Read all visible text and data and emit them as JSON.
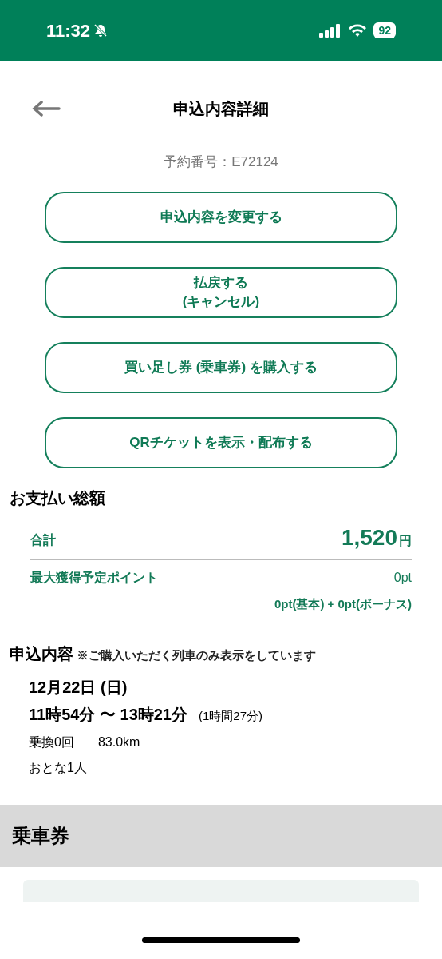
{
  "status_bar": {
    "time": "11:32",
    "battery": "92"
  },
  "header": {
    "title": "申込内容詳細"
  },
  "reservation_number": "予約番号：E72124",
  "actions": [
    {
      "lines": [
        "申込内容を変更する"
      ]
    },
    {
      "lines": [
        "払戻する",
        "(キャンセル)"
      ]
    },
    {
      "lines": [
        "買い足し券 (乗車券) を購入する"
      ]
    },
    {
      "lines": [
        "QRチケットを表示・配布する"
      ]
    }
  ],
  "payment": {
    "heading": "お支払い総額",
    "total_label": "合計",
    "total_amount": "1,520",
    "total_unit": "円",
    "points_label": "最大獲得予定ポイント",
    "points_value": "0pt",
    "points_breakdown": "0pt(基本) + 0pt(ボーナス)"
  },
  "application": {
    "heading": "申込内容",
    "note": "※ご購入いただく列車のみ表示をしています",
    "date": "12月22日 (日)",
    "time_range": "11時54分 〜 13時21分",
    "duration": "(1時間27分)",
    "transfers": "乗換0回",
    "distance": "83.0km",
    "passengers": "おとな1人"
  },
  "ticket_section": {
    "heading": "乗車券"
  }
}
